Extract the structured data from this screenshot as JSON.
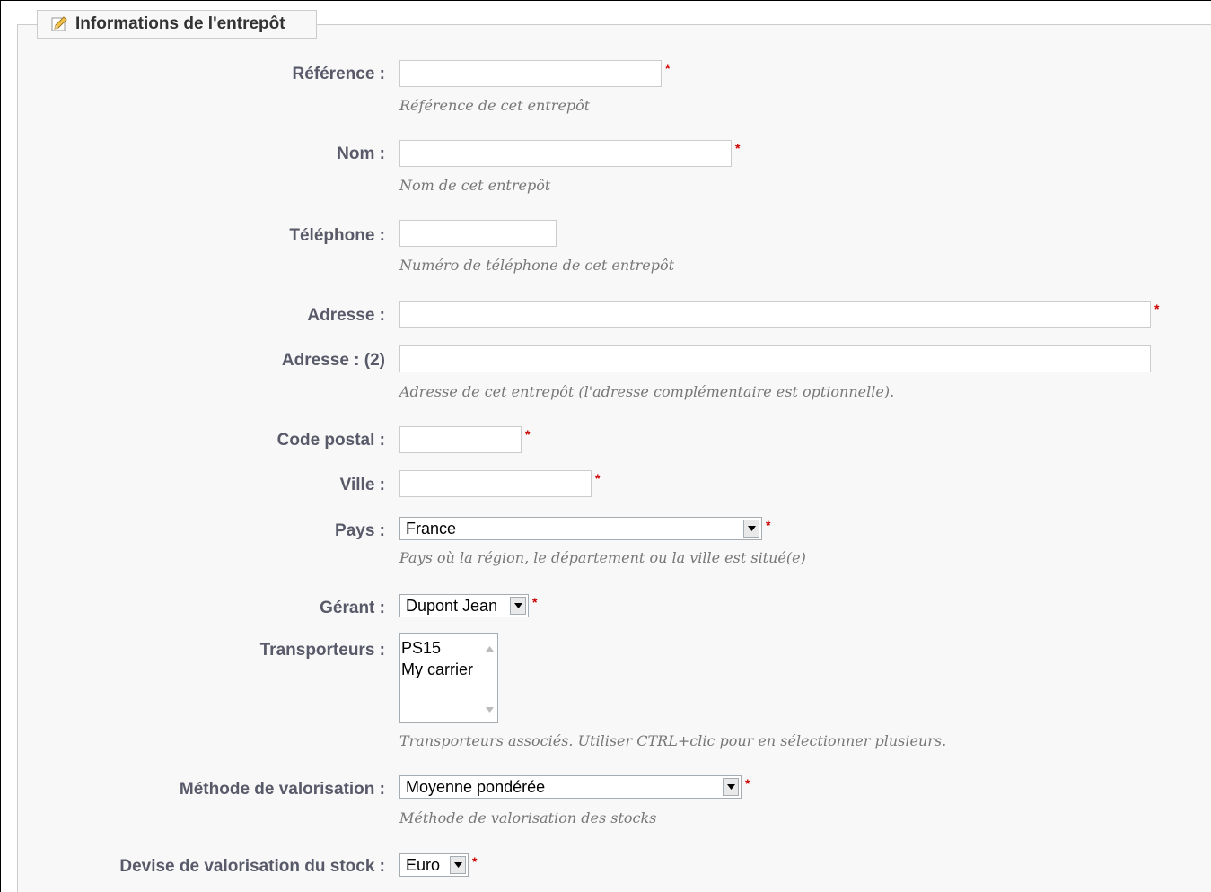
{
  "legend": {
    "title": "Informations de l'entrepôt",
    "icon": "pencil-icon"
  },
  "fields": {
    "reference": {
      "label": "Référence :",
      "value": "",
      "hint": "Référence de cet entrepôt",
      "required": true
    },
    "nom": {
      "label": "Nom :",
      "value": "",
      "hint": "Nom de cet entrepôt",
      "required": true
    },
    "telephone": {
      "label": "Téléphone :",
      "value": "",
      "hint": "Numéro de téléphone de cet entrepôt",
      "required": false
    },
    "adresse": {
      "label": "Adresse :",
      "value": "",
      "required": true
    },
    "adresse2": {
      "label": "Adresse : (2)",
      "value": "",
      "hint": "Adresse de cet entrepôt (l'adresse complémentaire est optionnelle).",
      "required": false
    },
    "code_postal": {
      "label": "Code postal :",
      "value": "",
      "required": true
    },
    "ville": {
      "label": "Ville :",
      "value": "",
      "required": true
    },
    "pays": {
      "label": "Pays :",
      "selected": "France",
      "hint": "Pays où la région, le département ou la ville est situé(e)",
      "required": true
    },
    "gerant": {
      "label": "Gérant :",
      "selected": "Dupont Jean",
      "required": true
    },
    "transporteurs": {
      "label": "Transporteurs :",
      "options": [
        "PS15",
        "My carrier"
      ],
      "hint": "Transporteurs associés. Utiliser CTRL+clic pour en sélectionner plusieurs."
    },
    "methode": {
      "label": "Méthode de valorisation :",
      "selected": "Moyenne pondérée",
      "hint": "Méthode de valorisation des stocks",
      "required": true
    },
    "devise": {
      "label": "Devise de valorisation du stock :",
      "selected": "Euro",
      "required": true
    }
  },
  "required_marker": "*",
  "colors": {
    "required": "#cc0000",
    "label": "#585a69",
    "hint": "#777777",
    "background": "#f8f8f8"
  }
}
